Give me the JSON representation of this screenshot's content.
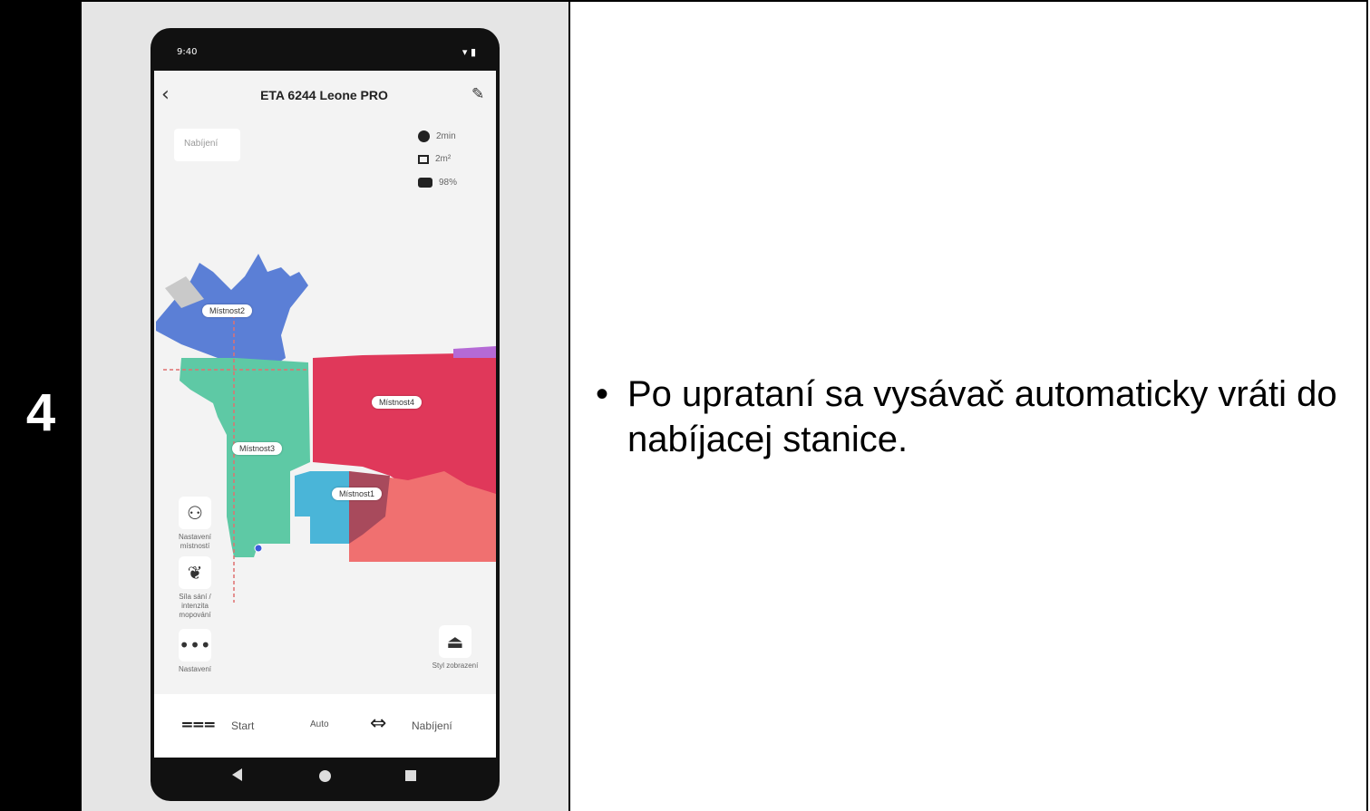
{
  "step": {
    "number": "4"
  },
  "instruction": {
    "bullet": "•",
    "text": "Po uprataní sa vysávač automaticky vráti do nabíjacej stanice."
  },
  "phone": {
    "status_time": "9:40",
    "title": "ETA 6244 Leone PRO",
    "status_label": "Nabíjení",
    "stats": {
      "time": "2min",
      "area": "2m²",
      "battery": "98%"
    },
    "rooms": [
      "Místnost2",
      "Místnost4",
      "Místnost3",
      "Místnost1"
    ],
    "side_buttons": {
      "room_settings": "Nastavení místností",
      "suction": "Síla sání / intenzita mopování",
      "settings": "Nastavení",
      "map_view": "Styl zobrazení"
    },
    "bottom": {
      "start": "Start",
      "mode": "Auto",
      "charge": "Nabíjení"
    }
  },
  "colors": {
    "room_blue": "#5b7fd6",
    "room_green": "#5ec9a5",
    "room_red": "#e0385a",
    "room_cyan": "#4ab5d8",
    "room_salmon": "#f07070"
  }
}
